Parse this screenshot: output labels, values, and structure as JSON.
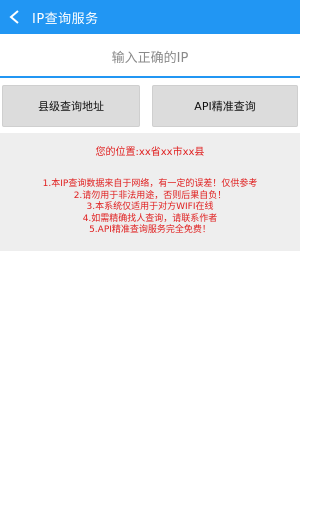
{
  "appbar": {
    "back_icon": "arrow-left-icon",
    "title": "IP查询服务",
    "color": "#2196f3"
  },
  "search": {
    "placeholder": "输入正确的IP",
    "value": ""
  },
  "buttons": {
    "county_lookup": "县级查询地址",
    "api_precise": "API精准查询"
  },
  "info": {
    "location": "您的位置:xx省xx市xx县",
    "notices": [
      "1.本IP查询数据来自于网络，有一定的误差！仅供参考",
      "2.请勿用于非法用途，否则后果自负！",
      "3.本系统仅适用于对方WIFI在线",
      "4.如需精确找人查询，请联系作者",
      "5.API精准查询服务完全免费！"
    ],
    "text_color": "#e02020"
  }
}
